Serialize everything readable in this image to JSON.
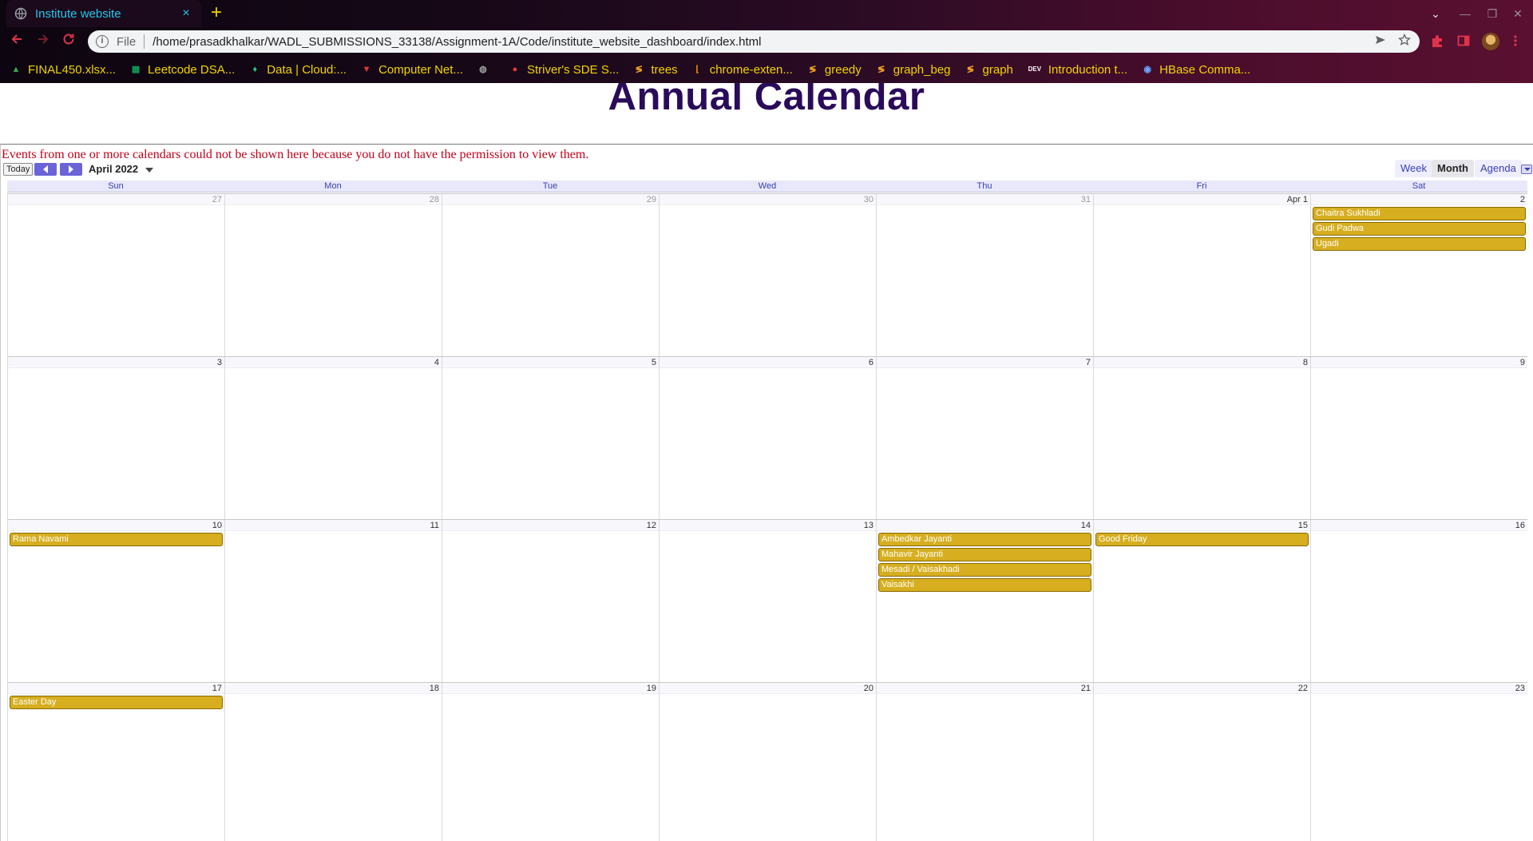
{
  "browser": {
    "tab": {
      "title": "Institute website",
      "close": "×"
    },
    "new_tab": "+",
    "window": {
      "dropdown": "⌄",
      "minimize": "—",
      "restore": "❐",
      "close": "✕"
    },
    "omnibox": {
      "scheme": "File",
      "url": "/home/prasadkhalkar/WADL_SUBMISSIONS_33138/Assignment-1A/Code/institute_website_dashboard/index.html"
    },
    "bookmarks": [
      {
        "label": "FINAL450.xlsx...",
        "icon": "drive-icon",
        "color": "#34a853"
      },
      {
        "label": "Leetcode DSA...",
        "icon": "sheets-icon",
        "color": "#0f9d58"
      },
      {
        "label": "Data | Cloud:...",
        "icon": "leaf-icon",
        "color": "#21c38a"
      },
      {
        "label": "Computer Net...",
        "icon": "v-logo-icon",
        "color": "#e53935"
      },
      {
        "label": "",
        "icon": "globe-icon",
        "color": "#9e9e9e"
      },
      {
        "label": "Striver's SDE S...",
        "icon": "tuf-icon",
        "color": "#e53935"
      },
      {
        "label": "trees",
        "icon": "codechef-icon",
        "color": "#f9a825"
      },
      {
        "label": "chrome-exten...",
        "icon": "leetcode-icon",
        "color": "#ff9800"
      },
      {
        "label": "greedy",
        "icon": "codechef-icon",
        "color": "#f9a825"
      },
      {
        "label": "graph_beg",
        "icon": "codechef-icon",
        "color": "#f9a825"
      },
      {
        "label": "graph",
        "icon": "codechef-icon",
        "color": "#f9a825"
      },
      {
        "label": "Introduction t...",
        "icon": "dev-icon",
        "color": "#ffffff"
      },
      {
        "label": "HBase Comma...",
        "icon": "hbase-icon",
        "color": "#6aa6ff"
      }
    ]
  },
  "page": {
    "title": "Annual Calendar"
  },
  "calendar": {
    "warning": "Events from one or more calendars could not be shown here because you do not have the permission to view them.",
    "today_label": "Today",
    "month_label": "April 2022",
    "views": [
      "Week",
      "Month",
      "Agenda"
    ],
    "active_view": "Month",
    "weekdays": [
      "Sun",
      "Mon",
      "Tue",
      "Wed",
      "Thu",
      "Fri",
      "Sat"
    ],
    "event_color": "#d6ae1f",
    "weeks": [
      {
        "days": [
          {
            "label": "27",
            "other": true,
            "events": []
          },
          {
            "label": "28",
            "other": true,
            "events": []
          },
          {
            "label": "29",
            "other": true,
            "events": []
          },
          {
            "label": "30",
            "other": true,
            "events": []
          },
          {
            "label": "31",
            "other": true,
            "events": []
          },
          {
            "label": "Apr 1",
            "other": false,
            "events": []
          },
          {
            "label": "2",
            "other": false,
            "events": [
              "Chaitra Sukhladi",
              "Gudi Padwa",
              "Ugadi"
            ]
          }
        ]
      },
      {
        "days": [
          {
            "label": "3",
            "other": false,
            "events": []
          },
          {
            "label": "4",
            "other": false,
            "events": []
          },
          {
            "label": "5",
            "other": false,
            "events": []
          },
          {
            "label": "6",
            "other": false,
            "events": []
          },
          {
            "label": "7",
            "other": false,
            "events": []
          },
          {
            "label": "8",
            "other": false,
            "events": []
          },
          {
            "label": "9",
            "other": false,
            "events": []
          }
        ]
      },
      {
        "days": [
          {
            "label": "10",
            "other": false,
            "events": [
              "Rama Navami"
            ]
          },
          {
            "label": "11",
            "other": false,
            "events": []
          },
          {
            "label": "12",
            "other": false,
            "events": []
          },
          {
            "label": "13",
            "other": false,
            "events": []
          },
          {
            "label": "14",
            "other": false,
            "events": [
              "Ambedkar Jayanti",
              "Mahavir Jayanti",
              "Mesadi / Vaisakhadi",
              "Vaisakhi"
            ]
          },
          {
            "label": "15",
            "other": false,
            "events": [
              "Good Friday"
            ]
          },
          {
            "label": "16",
            "other": false,
            "events": []
          }
        ]
      },
      {
        "days": [
          {
            "label": "17",
            "other": false,
            "events": [
              "Easter Day"
            ]
          },
          {
            "label": "18",
            "other": false,
            "events": []
          },
          {
            "label": "19",
            "other": false,
            "events": []
          },
          {
            "label": "20",
            "other": false,
            "events": []
          },
          {
            "label": "21",
            "other": false,
            "events": []
          },
          {
            "label": "22",
            "other": false,
            "events": []
          },
          {
            "label": "23",
            "other": false,
            "events": []
          }
        ]
      }
    ]
  }
}
